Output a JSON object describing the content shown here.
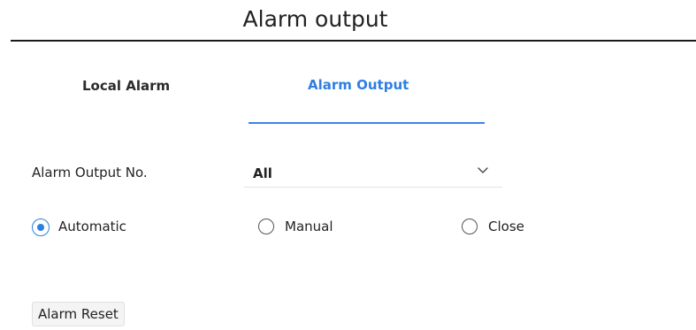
{
  "header": {
    "title": "Alarm output"
  },
  "tabs": [
    {
      "label": "Local Alarm",
      "active": false
    },
    {
      "label": "Alarm Output",
      "active": true
    }
  ],
  "form": {
    "output_no_label": "Alarm Output No.",
    "output_no_value": "All",
    "mode_options": [
      {
        "label": "Automatic",
        "checked": true
      },
      {
        "label": "Manual",
        "checked": false
      },
      {
        "label": "Close",
        "checked": false
      }
    ]
  },
  "actions": {
    "reset_label": "Alarm Reset"
  },
  "colors": {
    "accent": "#2f7fe0",
    "text": "#222222",
    "rule": "#1a1a1a"
  },
  "icons": {
    "dropdown": "chevron-down-icon",
    "radio_checked": "radio-checked-icon",
    "radio_unchecked": "radio-unchecked-icon"
  }
}
